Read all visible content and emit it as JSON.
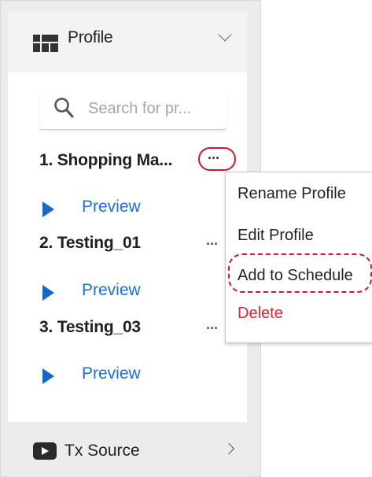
{
  "panel": {
    "title": "Profile",
    "icon": "profile-grid-icon",
    "expand_icon": "chevron-down-icon"
  },
  "search": {
    "placeholder": "Search for pr..."
  },
  "profiles": [
    {
      "title": "1. Shopping Ma...",
      "preview_label": "Preview",
      "more_label": "···"
    },
    {
      "title": "2. Testing_01",
      "preview_label": "Preview",
      "more_label": "···"
    },
    {
      "title": "3. Testing_03",
      "preview_label": "Preview",
      "more_label": "···"
    }
  ],
  "context_menu": {
    "items": [
      {
        "label": "Rename Profile"
      },
      {
        "label": "Edit Profile"
      },
      {
        "label": "Add to Schedule"
      },
      {
        "label": "Delete"
      }
    ]
  },
  "tx_source": {
    "title": "Tx Source",
    "icon": "tx-source-play-icon",
    "expand_icon": "chevron-right-icon"
  },
  "colors": {
    "accent_blue": "#1f6fce",
    "delete_red": "#e0242f",
    "highlight_red": "#c81a2a"
  }
}
